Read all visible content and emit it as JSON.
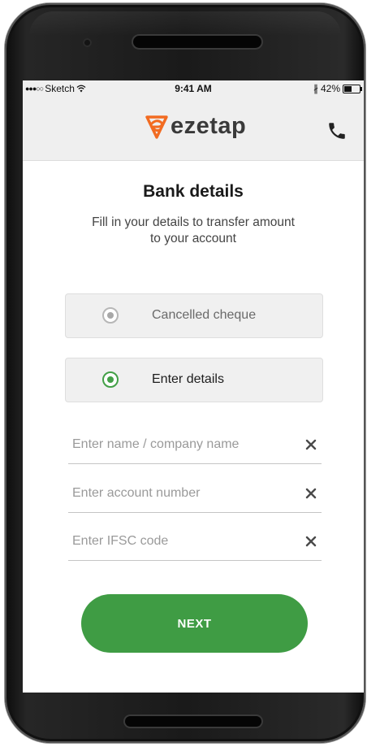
{
  "status_bar": {
    "signal": "●●●○○",
    "carrier": "Sketch",
    "time": "9:41 AM",
    "bluetooth": "∦",
    "battery": "42%"
  },
  "app_bar": {
    "logo_text": "ezetap",
    "brand_color": "#f26b21",
    "call_icon": "phone-icon"
  },
  "page": {
    "title": "Bank details",
    "subtitle": "Fill in your details to transfer amount to your account"
  },
  "options": [
    {
      "label": "Cancelled cheque",
      "selected": false
    },
    {
      "label": "Enter details",
      "selected": true
    }
  ],
  "fields": [
    {
      "placeholder": "Enter name / company name",
      "value": ""
    },
    {
      "placeholder": "Enter account number",
      "value": ""
    },
    {
      "placeholder": "Enter IFSC code",
      "value": ""
    }
  ],
  "next_button": {
    "label": "NEXT",
    "color": "#3f9c44"
  },
  "colors": {
    "accent_green": "#43a047",
    "brand_orange": "#f26b21"
  }
}
